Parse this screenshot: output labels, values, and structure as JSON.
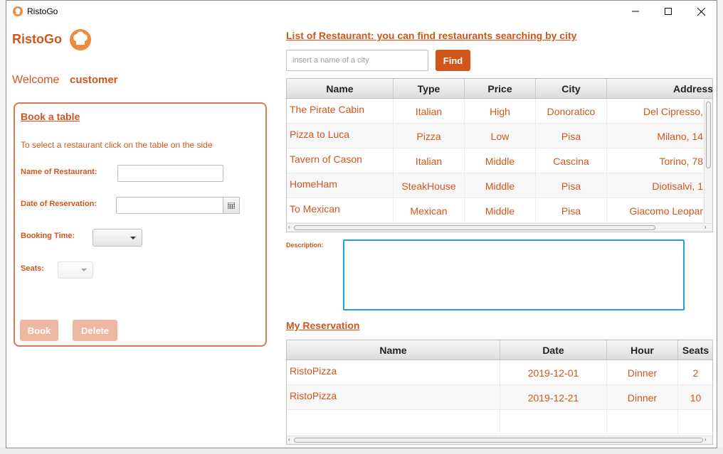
{
  "window": {
    "title": "RistoGo",
    "minimize_glyph": "—",
    "maximize_glyph": "☐",
    "close_glyph": "✕"
  },
  "sidebar": {
    "logo_text": "RistoGo",
    "logo_icon": "chef-hat-icon",
    "welcome_label": "Welcome",
    "user_name": "customer"
  },
  "booking": {
    "title": "Book a table",
    "hint": "To select a restaurant click on the table on the side",
    "restaurant_label": "Name of Restaurant:",
    "restaurant_value": "",
    "date_label": "Date of Reservation:",
    "date_value": "",
    "time_label": "Booking Time:",
    "time_value": "",
    "seats_label": "Seats:",
    "seats_value": "",
    "book_button": "Book",
    "delete_button": "Delete"
  },
  "restaurants": {
    "title": "List of Restaurant: you can find restaurants searching by city",
    "search_placeholder": "insert a name of a city",
    "find_button": "Find",
    "columns": [
      "Name",
      "Type",
      "Price",
      "City",
      "Address"
    ],
    "rows": [
      [
        "The Pirate Cabin",
        "Italian",
        "High",
        "Donoratico",
        "Del Cipresso, "
      ],
      [
        "Pizza to Luca",
        "Pizza",
        "Low",
        "Pisa",
        "Milano, 14"
      ],
      [
        "Tavern of Cason",
        "Italian",
        "Middle",
        "Cascina",
        "Torino, 78"
      ],
      [
        "HomeHam",
        "SteakHouse",
        "Middle",
        "Pisa",
        "Diotisalvi, 1"
      ],
      [
        "To Mexican",
        "Mexican",
        "Middle",
        "Pisa",
        "Giacomo Leopar"
      ]
    ]
  },
  "description": {
    "label": "Description:",
    "value": ""
  },
  "reservations": {
    "title": "My Reservation",
    "columns": [
      "Name",
      "Date",
      "Hour",
      "Seats"
    ],
    "rows": [
      [
        "RistoPizza",
        "2019-12-01",
        "Dinner",
        "2"
      ],
      [
        "RistoPizza",
        "2019-12-21",
        "Dinner",
        "10"
      ]
    ]
  },
  "colors": {
    "accent": "#d1561c",
    "focus": "#1ea4d8"
  }
}
